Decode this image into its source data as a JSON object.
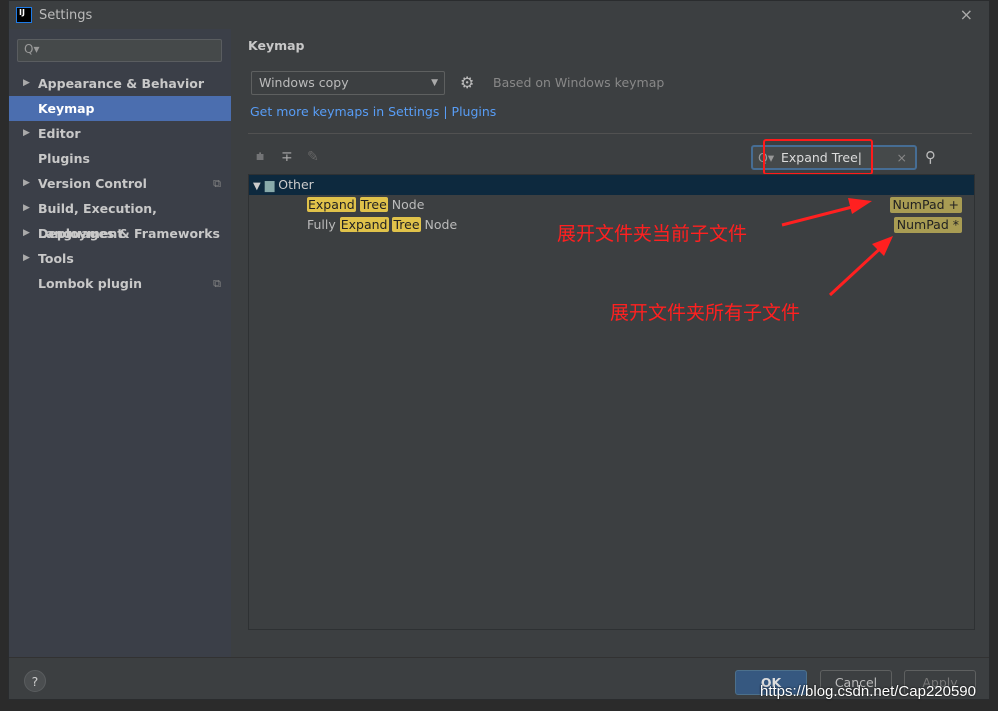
{
  "window": {
    "title": "Settings",
    "close": "×",
    "logo": "IJ"
  },
  "sidebar": {
    "search_placeholder": "Q▾",
    "items": [
      {
        "label": "Appearance & Behavior",
        "expandable": true
      },
      {
        "label": "Keymap",
        "selected": true
      },
      {
        "label": "Editor",
        "expandable": true
      },
      {
        "label": "Plugins"
      },
      {
        "label": "Version Control",
        "expandable": true,
        "copy": true
      },
      {
        "label": "Build, Execution, Deployment",
        "expandable": true
      },
      {
        "label": "Languages & Frameworks",
        "expandable": true
      },
      {
        "label": "Tools",
        "expandable": true
      },
      {
        "label": "Lombok plugin",
        "copy": true
      }
    ]
  },
  "main": {
    "heading": "Keymap",
    "keymap_value": "Windows copy",
    "based_on": "Based on Windows keymap",
    "link": "Get more keymaps in Settings | Plugins",
    "filter_value": "Expand Tree",
    "tree": {
      "group": "Other",
      "rows": [
        {
          "parts": [
            {
              "t": "Expand",
              "hl": true
            },
            {
              "t": " "
            },
            {
              "t": "Tree",
              "hl": true
            },
            {
              "t": " Node"
            }
          ],
          "shortcut": "NumPad +"
        },
        {
          "parts": [
            {
              "t": "Fully "
            },
            {
              "t": "Expand",
              "hl": true
            },
            {
              "t": " "
            },
            {
              "t": "Tree",
              "hl": true
            },
            {
              "t": " Node"
            }
          ],
          "shortcut": "NumPad *"
        }
      ]
    }
  },
  "annotations": {
    "a1": "展开文件夹当前子文件",
    "a2": "展开文件夹所有子文件",
    "color": "#ff2020"
  },
  "footer": {
    "help": "?",
    "ok": "OK",
    "cancel": "Cancel",
    "apply": "Apply"
  },
  "watermark": "https://blog.csdn.net/Cap220590"
}
